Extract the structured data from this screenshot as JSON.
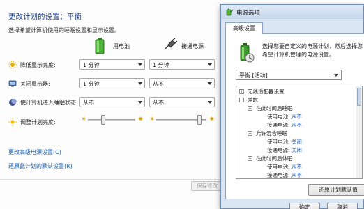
{
  "background": {
    "title": "更改计划的设置：平衡",
    "subtitle": "选择希望计算机使用的睡眠设置和显示设置。",
    "columns": {
      "battery": "用电池",
      "plugged": "接通电源"
    },
    "rows": [
      {
        "label": "降低显示亮度:",
        "battery": "1 分钟",
        "plugged": "1 分钟"
      },
      {
        "label": "关闭显示器:",
        "battery": "1 分钟",
        "plugged": "从不"
      },
      {
        "label": "使计算机进入睡眠状态:",
        "battery": "从不",
        "plugged": "从不"
      }
    ],
    "brightness_label": "调整计划亮度:",
    "brightness_battery_level": 0.3,
    "brightness_plugged_level": 0.9,
    "advanced_link": "更改高级电源设置(C)",
    "restore_link": "还原此计划的默认设置(R)",
    "save_button": "保存修改"
  },
  "dialog": {
    "title": "电源选项",
    "tab": "高级设置",
    "description": "选择您要自定义的电源计划，然后选择您希望计算机管理的电源设置。",
    "plan": "平衡 [活动]",
    "tree": {
      "wireless": "无线适配器设置",
      "sleep": "睡眠",
      "after_sleep": "在此时间后睡眠",
      "battery_label": "使用电池:",
      "battery_value": "从不",
      "plugged_label": "接通电源:",
      "plugged_value": "从不",
      "hybrid": "允许混合睡眠",
      "hybrid_battery_label": "使用电池:",
      "hybrid_battery_value": "关闭",
      "hybrid_plugged_label": "接通电源:",
      "hybrid_plugged_value": "关闭",
      "hibernate": "在此时间后休眠",
      "hib_battery_label": "使用电池:",
      "hib_battery_value": "从不",
      "hib_plugged_label": "接通电源:",
      "hib_plugged_value": "从不"
    },
    "restore_button": "还原计划默认值",
    "ok_button": "确定",
    "cancel_button": "取消"
  },
  "colors": {
    "title_blue": "#1d3f8a",
    "link_blue": "#1a5fb4",
    "value_blue": "#2b67c4",
    "dialog_bg": "#dae6f3"
  }
}
